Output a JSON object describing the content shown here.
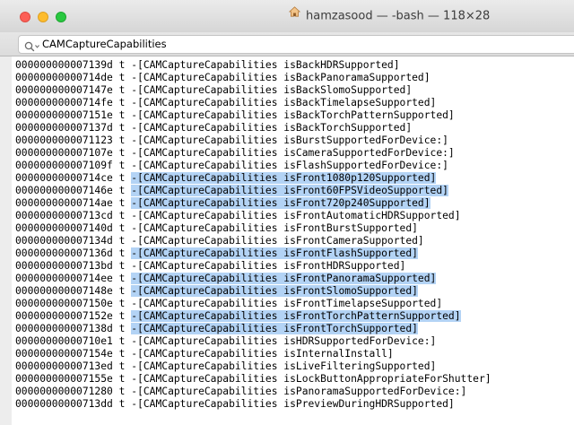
{
  "window": {
    "title": "hamzasood — -bash — 118×28",
    "title_icon": "home-icon"
  },
  "find": {
    "query": "CAMCaptureCapabilities",
    "icon": "search-icon"
  },
  "colors": {
    "highlight": "#b3d3f5",
    "close": "#fc5f57",
    "minimize": "#fdbc2e",
    "zoom": "#29c840"
  },
  "terminal": {
    "lines": [
      {
        "addr": "000000000007139d",
        "sym": "t",
        "call": "-[CAMCaptureCapabilities isBackHDRSupported]",
        "highlighted": false
      },
      {
        "addr": "00000000000714de",
        "sym": "t",
        "call": "-[CAMCaptureCapabilities isBackPanoramaSupported]",
        "highlighted": false
      },
      {
        "addr": "000000000007147e",
        "sym": "t",
        "call": "-[CAMCaptureCapabilities isBackSlomoSupported]",
        "highlighted": false
      },
      {
        "addr": "00000000000714fe",
        "sym": "t",
        "call": "-[CAMCaptureCapabilities isBackTimelapseSupported]",
        "highlighted": false
      },
      {
        "addr": "000000000007151e",
        "sym": "t",
        "call": "-[CAMCaptureCapabilities isBackTorchPatternSupported]",
        "highlighted": false
      },
      {
        "addr": "000000000007137d",
        "sym": "t",
        "call": "-[CAMCaptureCapabilities isBackTorchSupported]",
        "highlighted": false
      },
      {
        "addr": "0000000000071123",
        "sym": "t",
        "call": "-[CAMCaptureCapabilities isBurstSupportedForDevice:]",
        "highlighted": false
      },
      {
        "addr": "000000000007107e",
        "sym": "t",
        "call": "-[CAMCaptureCapabilities isCameraSupportedForDevice:]",
        "highlighted": false
      },
      {
        "addr": "000000000007109f",
        "sym": "t",
        "call": "-[CAMCaptureCapabilities isFlashSupportedForDevice:]",
        "highlighted": false
      },
      {
        "addr": "00000000000714ce",
        "sym": "t",
        "call": "-[CAMCaptureCapabilities isFront1080p120Supported]",
        "highlighted": true
      },
      {
        "addr": "000000000007146e",
        "sym": "t",
        "call": "-[CAMCaptureCapabilities isFront60FPSVideoSupported]",
        "highlighted": true
      },
      {
        "addr": "00000000000714ae",
        "sym": "t",
        "call": "-[CAMCaptureCapabilities isFront720p240Supported]",
        "highlighted": true
      },
      {
        "addr": "00000000000713cd",
        "sym": "t",
        "call": "-[CAMCaptureCapabilities isFrontAutomaticHDRSupported]",
        "highlighted": false
      },
      {
        "addr": "000000000007140d",
        "sym": "t",
        "call": "-[CAMCaptureCapabilities isFrontBurstSupported]",
        "highlighted": false
      },
      {
        "addr": "000000000007134d",
        "sym": "t",
        "call": "-[CAMCaptureCapabilities isFrontCameraSupported]",
        "highlighted": false
      },
      {
        "addr": "000000000007136d",
        "sym": "t",
        "call": "-[CAMCaptureCapabilities isFrontFlashSupported]",
        "highlighted": true
      },
      {
        "addr": "00000000000713bd",
        "sym": "t",
        "call": "-[CAMCaptureCapabilities isFrontHDRSupported]",
        "highlighted": false
      },
      {
        "addr": "00000000000714ee",
        "sym": "t",
        "call": "-[CAMCaptureCapabilities isFrontPanoramaSupported]",
        "highlighted": true
      },
      {
        "addr": "000000000007148e",
        "sym": "t",
        "call": "-[CAMCaptureCapabilities isFrontSlomoSupported]",
        "highlighted": true
      },
      {
        "addr": "000000000007150e",
        "sym": "t",
        "call": "-[CAMCaptureCapabilities isFrontTimelapseSupported]",
        "highlighted": false
      },
      {
        "addr": "000000000007152e",
        "sym": "t",
        "call": "-[CAMCaptureCapabilities isFrontTorchPatternSupported]",
        "highlighted": true
      },
      {
        "addr": "000000000007138d",
        "sym": "t",
        "call": "-[CAMCaptureCapabilities isFrontTorchSupported]",
        "highlighted": true
      },
      {
        "addr": "00000000000710e1",
        "sym": "t",
        "call": "-[CAMCaptureCapabilities isHDRSupportedForDevice:]",
        "highlighted": false
      },
      {
        "addr": "000000000007154e",
        "sym": "t",
        "call": "-[CAMCaptureCapabilities isInternalInstall]",
        "highlighted": false
      },
      {
        "addr": "00000000000713ed",
        "sym": "t",
        "call": "-[CAMCaptureCapabilities isLiveFilteringSupported]",
        "highlighted": false
      },
      {
        "addr": "000000000007155e",
        "sym": "t",
        "call": "-[CAMCaptureCapabilities isLockButtonAppropriateForShutter]",
        "highlighted": false
      },
      {
        "addr": "0000000000071280",
        "sym": "t",
        "call": "-[CAMCaptureCapabilities isPanoramaSupportedForDevice:]",
        "highlighted": false
      },
      {
        "addr": "00000000000713dd",
        "sym": "t",
        "call": "-[CAMCaptureCapabilities isPreviewDuringHDRSupported]",
        "highlighted": false
      }
    ]
  }
}
